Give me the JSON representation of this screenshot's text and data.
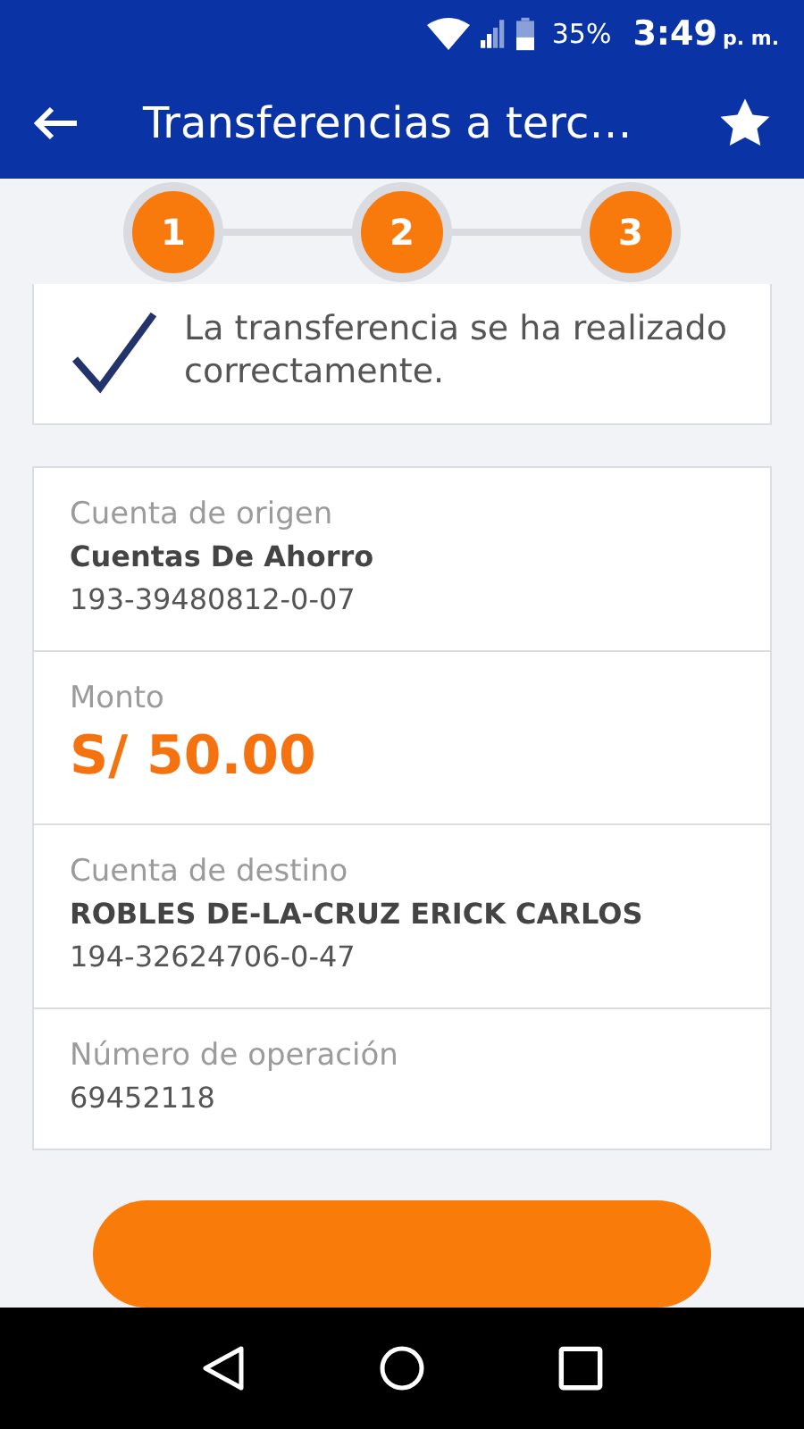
{
  "status_bar": {
    "battery": "35%",
    "time": "3:49",
    "time_suffix": "p. m."
  },
  "header": {
    "title": "Transferencias a terc…"
  },
  "steps": [
    {
      "label": "1"
    },
    {
      "label": "2"
    },
    {
      "label": "3"
    }
  ],
  "message": "La transferencia se ha realizado correctamente.",
  "details": [
    {
      "kind": "account",
      "label": "Cuenta de origen",
      "name": "Cuentas De Ahorro",
      "number": "193-39480812-0-07"
    },
    {
      "kind": "amount",
      "label": "Monto",
      "amount": "S/ 50.00"
    },
    {
      "kind": "account",
      "label": "Cuenta de destino",
      "name": "ROBLES DE-LA-CRUZ ERICK CARLOS",
      "number": "194-32624706-0-47"
    },
    {
      "kind": "plain",
      "label": "Número de operación",
      "number": "69452118"
    }
  ]
}
